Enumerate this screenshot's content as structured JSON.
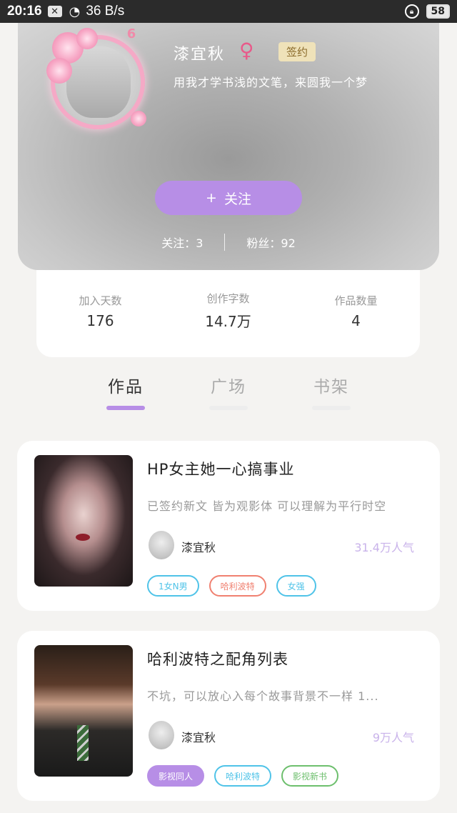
{
  "status_bar": {
    "time": "20:16",
    "notification_icon": "close-box-icon",
    "wifi_icon": "wifi-icon",
    "network_speed": "36 B/s",
    "lock_icon": "rotation-lock-icon",
    "battery": "58"
  },
  "profile": {
    "name": "漆宜秋",
    "gender_icon": "female-icon",
    "badge": "签约",
    "level": "6",
    "bio": "用我才学书浅的文笔，来圆我一个梦",
    "follow_button": "关注",
    "follow_icon": "+",
    "following": "关注：3",
    "followers": "粉丝：92"
  },
  "metrics": [
    {
      "label": "加入天数",
      "value": "176"
    },
    {
      "label": "创作字数",
      "value": "14.7万"
    },
    {
      "label": "作品数量",
      "value": "4"
    }
  ],
  "tabs": [
    {
      "label": "作品",
      "active": true
    },
    {
      "label": "广场",
      "active": false
    },
    {
      "label": "书架",
      "active": false
    }
  ],
  "books": [
    {
      "title": "HP女主她一心搞事业",
      "description": "已签约新文 皆为观影体 可以理解为平行时空",
      "author": "漆宜秋",
      "popularity": "31.4万人气",
      "tags": [
        {
          "label": "1女N男",
          "color": "#4fc3e8"
        },
        {
          "label": "哈利波特",
          "color": "#f08070"
        },
        {
          "label": "女强",
          "color": "#4fc3e8"
        }
      ]
    },
    {
      "title": "哈利波特之配角列表",
      "description": "不坑，可以放心入每个故事背景不一样 1...",
      "author": "漆宜秋",
      "popularity": "9万人气",
      "tags": [
        {
          "label": "影视同人",
          "color": "#b78ee6",
          "filled": true
        },
        {
          "label": "哈利波特",
          "color": "#4fc3e8"
        },
        {
          "label": "影视新书",
          "color": "#6dbf6d"
        }
      ]
    }
  ],
  "colors": {
    "accent": "#b78ee6",
    "signed_badge_bg": "#efe2b9",
    "gender": "#e85a8a"
  }
}
